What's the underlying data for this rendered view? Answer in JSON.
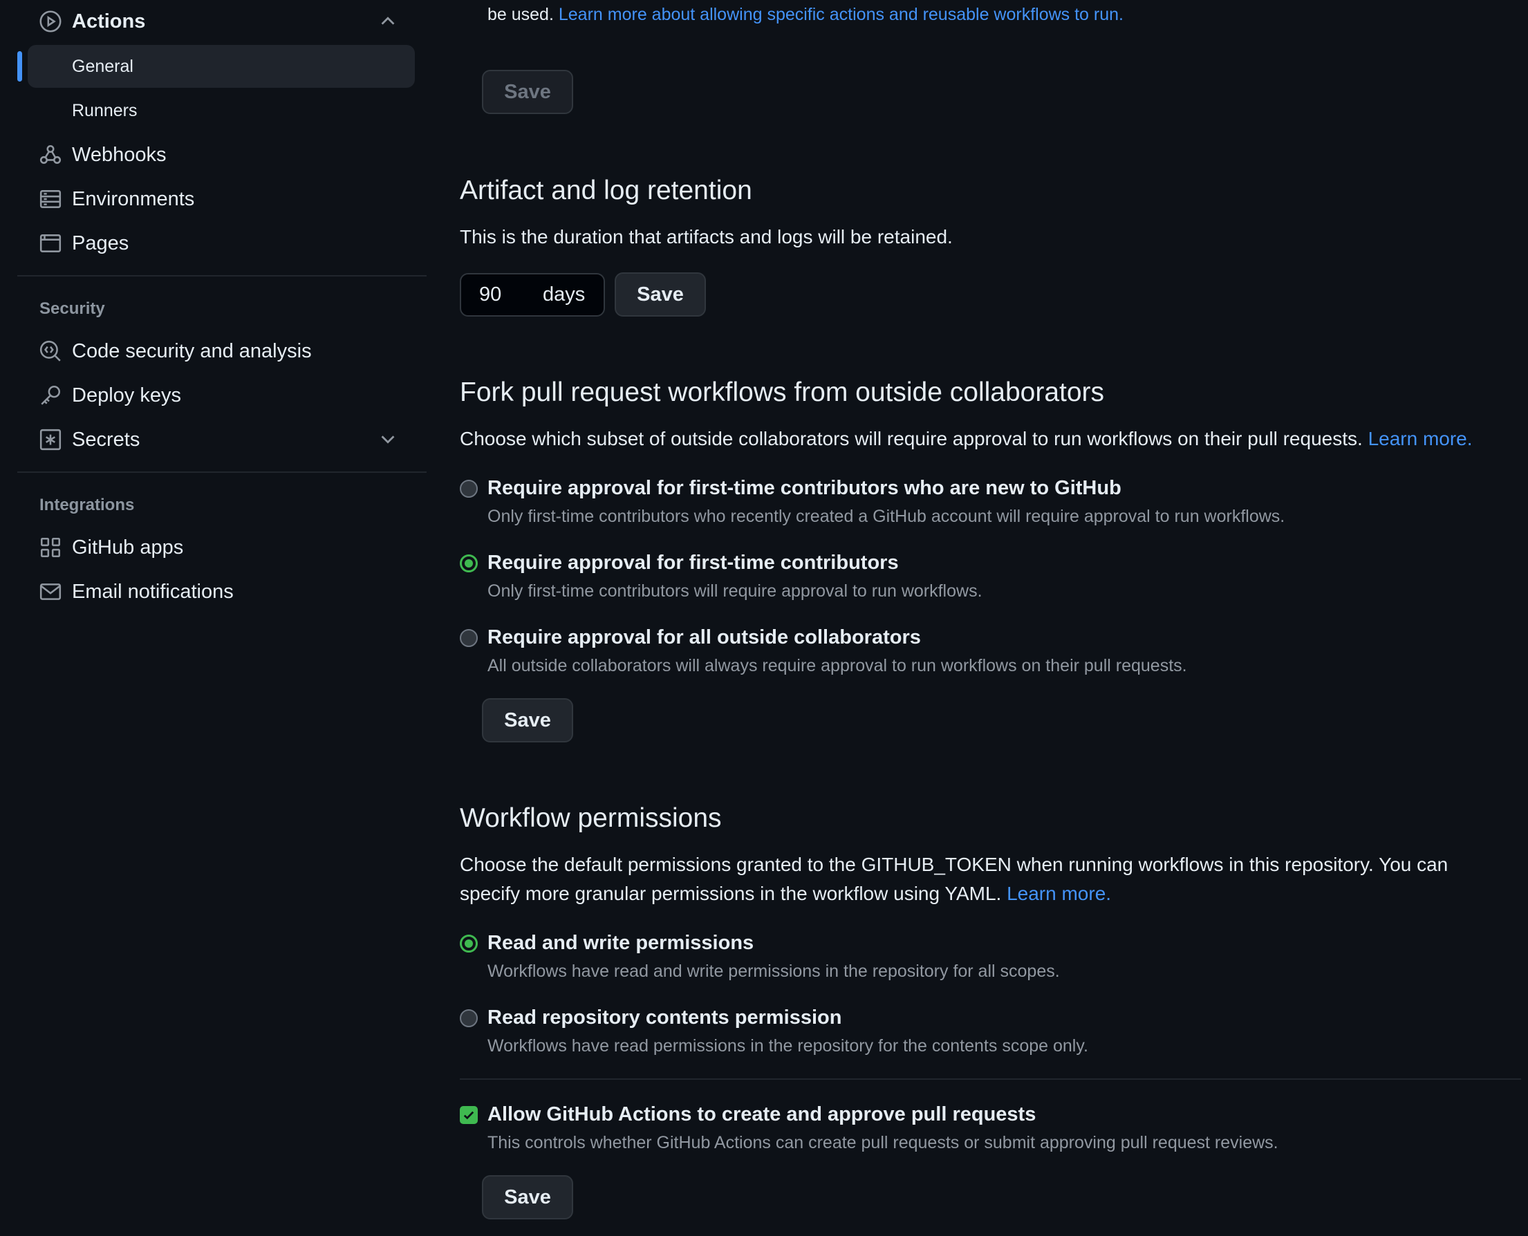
{
  "sidebar": {
    "actions_label": "Actions",
    "general_label": "General",
    "runners_label": "Runners",
    "webhooks_label": "Webhooks",
    "environments_label": "Environments",
    "pages_label": "Pages",
    "security_group": "Security",
    "code_security_label": "Code security and analysis",
    "deploy_keys_label": "Deploy keys",
    "secrets_label": "Secrets",
    "integrations_group": "Integrations",
    "github_apps_label": "GitHub apps",
    "email_notifications_label": "Email notifications"
  },
  "top": {
    "text": "be used.",
    "link": "Learn more about allowing specific actions and reusable workflows to run.",
    "save_label": "Save"
  },
  "artifact": {
    "title": "Artifact and log retention",
    "description": "This is the duration that artifacts and logs will be retained.",
    "days_value": "90",
    "days_unit": "days",
    "save_label": "Save"
  },
  "fork": {
    "title": "Fork pull request workflows from outside collaborators",
    "description": "Choose which subset of outside collaborators will require approval to run workflows on their pull requests.",
    "link": "Learn more.",
    "options": [
      {
        "title": "Require approval for first-time contributors who are new to GitHub",
        "subtitle": "Only first-time contributors who recently created a GitHub account will require approval to run workflows."
      },
      {
        "title": "Require approval for first-time contributors",
        "subtitle": "Only first-time contributors will require approval to run workflows."
      },
      {
        "title": "Require approval for all outside collaborators",
        "subtitle": "All outside collaborators will always require approval to run workflows on their pull requests."
      }
    ],
    "selected_index": 1,
    "save_label": "Save"
  },
  "workflow": {
    "title": "Workflow permissions",
    "description_line1": "Choose the default permissions granted to the GITHUB_TOKEN when running workflows in this repository. You can",
    "description_line2": "specify more granular permissions in the workflow using YAML.",
    "link": "Learn more.",
    "options": [
      {
        "title": "Read and write permissions",
        "subtitle": "Workflows have read and write permissions in the repository for all scopes."
      },
      {
        "title": "Read repository contents permission",
        "subtitle": "Workflows have read permissions in the repository for the contents scope only."
      }
    ],
    "selected_index": 0,
    "allow_pr_title": "Allow GitHub Actions to create and approve pull requests",
    "allow_pr_subtitle": "This controls whether GitHub Actions can create pull requests or submit approving pull request reviews.",
    "allow_pr_checked": true,
    "save_label": "Save"
  },
  "colors": {
    "background": "#0d1117",
    "accent": "#4493f8",
    "success": "#3fb950",
    "muted": "#9198a1"
  }
}
